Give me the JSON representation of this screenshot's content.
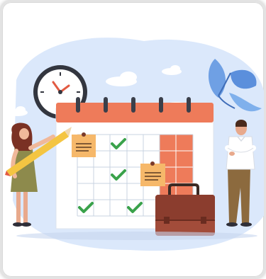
{
  "card": {
    "kind": "illustration",
    "theme": "calendar-scheduling"
  },
  "colors": {
    "sky_blob": "#dbe8fb",
    "calendar_header": "#ee7b5a",
    "calendar_body": "#ffffff",
    "grid_line": "#c9d3e0",
    "highlight_column": "#ee7b5a",
    "check_mark": "#3aa24b",
    "sticky_note": "#f6b86a",
    "clock_face": "#ffffff",
    "clock_rim": "#33363f",
    "leaf": "#6fa0e4",
    "briefcase": "#a24c3a",
    "pencil": "#f4c542",
    "woman_dress": "#8d8a4c",
    "woman_hair": "#7a3124",
    "man_shirt": "#ffffff",
    "man_pants": "#8c6a3e"
  },
  "icons": [
    "wall-clock-icon",
    "pencil-icon",
    "briefcase-icon",
    "checkmark-icon",
    "sticky-note-icon",
    "leaf-icon",
    "cloud-icon"
  ],
  "calendar": {
    "rings": 6,
    "rows": 5,
    "cols": 7,
    "checks": [
      {
        "row": 0,
        "col": 3
      },
      {
        "row": 2,
        "col": 3
      },
      {
        "row": 4,
        "col": 0
      },
      {
        "row": 4,
        "col": 3
      }
    ],
    "highlighted_col": 6
  }
}
